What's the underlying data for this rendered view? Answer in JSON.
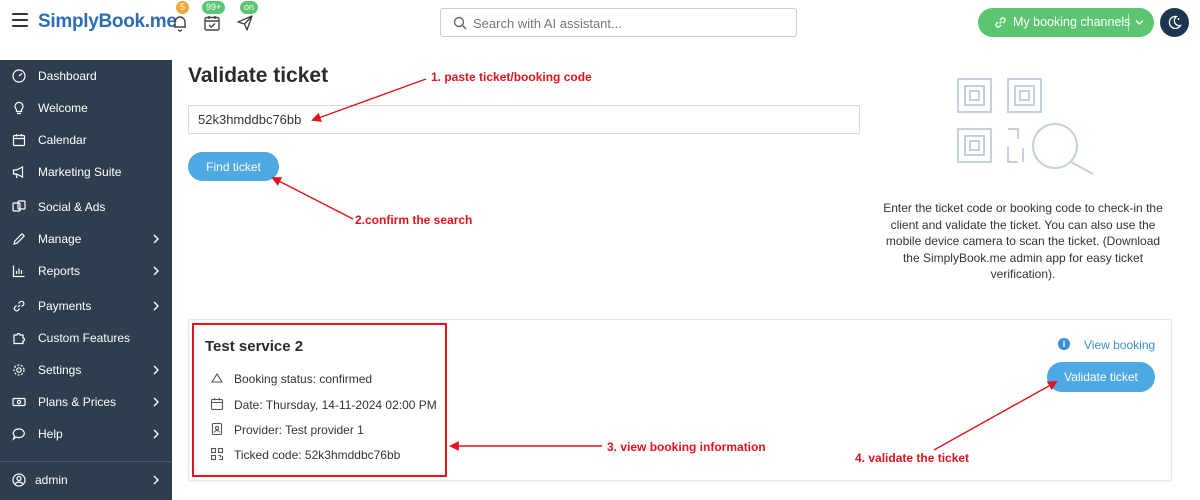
{
  "header": {
    "logo": "SimplyBook.me",
    "badges": {
      "notifications": "5",
      "bookings": "99+",
      "channels_status": "on"
    },
    "search_placeholder": "Search with AI assistant...",
    "booking_channels_label": "My booking channels"
  },
  "sidebar": {
    "items": [
      {
        "label": "Dashboard",
        "icon": "dashboard-icon"
      },
      {
        "label": "Welcome",
        "icon": "lightbulb-icon"
      },
      {
        "label": "Calendar",
        "icon": "calendar-icon"
      },
      {
        "label": "Marketing Suite",
        "icon": "megaphone-icon"
      },
      {
        "label": "Social & Ads",
        "icon": "social-icon"
      },
      {
        "label": "Manage",
        "icon": "pencil-icon"
      },
      {
        "label": "Reports",
        "icon": "chart-icon"
      },
      {
        "label": "Payments",
        "icon": "link-icon"
      },
      {
        "label": "Custom Features",
        "icon": "puzzle-icon"
      },
      {
        "label": "Settings",
        "icon": "gear-icon"
      },
      {
        "label": "Plans & Prices",
        "icon": "money-icon"
      },
      {
        "label": "Help",
        "icon": "chat-icon"
      }
    ],
    "user": "admin"
  },
  "main": {
    "title": "Validate ticket",
    "ticket_value": "52k3hmddbc76bb",
    "find_button": "Find ticket",
    "help_text": "Enter the ticket code or booking code to check-in the client and validate the ticket. You can also use the mobile device camera to scan the ticket. (Download the SimplyBook.me admin app for easy ticket verification)."
  },
  "booking": {
    "service": "Test service 2",
    "status": "Booking status: confirmed",
    "date": "Date: Thursday, 14-11-2024 02:00 PM",
    "provider": "Provider: Test provider 1",
    "code": "Ticked code: 52k3hmddbc76bb",
    "view_link": "View booking",
    "validate_button": "Validate ticket"
  },
  "annotations": {
    "step1": "1. paste ticket/booking code",
    "step2": "2.confirm the search",
    "step3": "3. view booking information",
    "step4": "4. validate the ticket"
  },
  "colors": {
    "sidebar_bg": "#2e3e4e",
    "primary_button": "#4ea8e2",
    "channels_button": "#5cc571",
    "annotation_red": "#e0141c"
  }
}
